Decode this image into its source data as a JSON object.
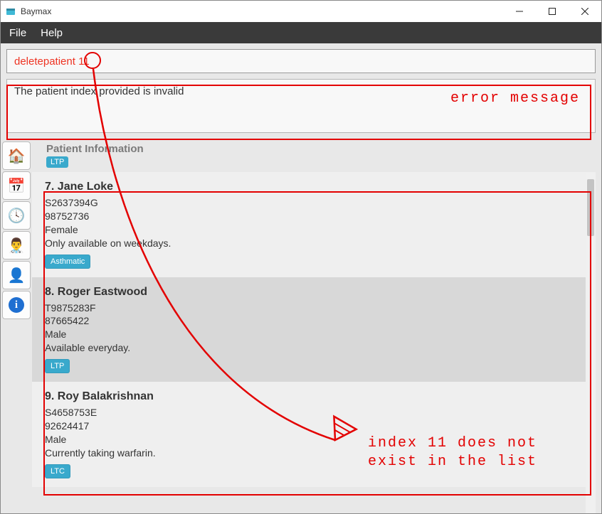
{
  "window": {
    "title": "Baymax"
  },
  "menubar": {
    "file": "File",
    "help": "Help"
  },
  "command": {
    "value": "deletepatient 11"
  },
  "result": {
    "message": "The patient index provided is invalid"
  },
  "section": {
    "title": "Patient Information",
    "header_tag": "LTP"
  },
  "patients": [
    {
      "index": "7.",
      "name": "Jane Loke",
      "nric": "S2637394G",
      "phone": "98752736",
      "gender": "Female",
      "note": "Only available on weekdays.",
      "tag_label": "Asthmatic",
      "tag_color": "#39a9cc",
      "shade": "light"
    },
    {
      "index": "8.",
      "name": "Roger Eastwood",
      "nric": "T9875283F",
      "phone": "87665422",
      "gender": "Male",
      "note": "Available everyday.",
      "tag_label": "LTP",
      "tag_color": "#39a9cc",
      "shade": "dark"
    },
    {
      "index": "9.",
      "name": "Roy Balakrishnan",
      "nric": "S4658753E",
      "phone": "92624417",
      "gender": "Male",
      "note": "Currently taking warfarin.",
      "tag_label": "LTC",
      "tag_color": "#39a9cc",
      "shade": "light"
    }
  ],
  "sidebar_icons": [
    "home-icon",
    "calendar-icon",
    "clock24-icon",
    "doctor-icon",
    "person-clock-icon",
    "info-icon"
  ],
  "annotations": {
    "error_label": "error message",
    "index_label": "index 11 does not\nexist in the list"
  }
}
